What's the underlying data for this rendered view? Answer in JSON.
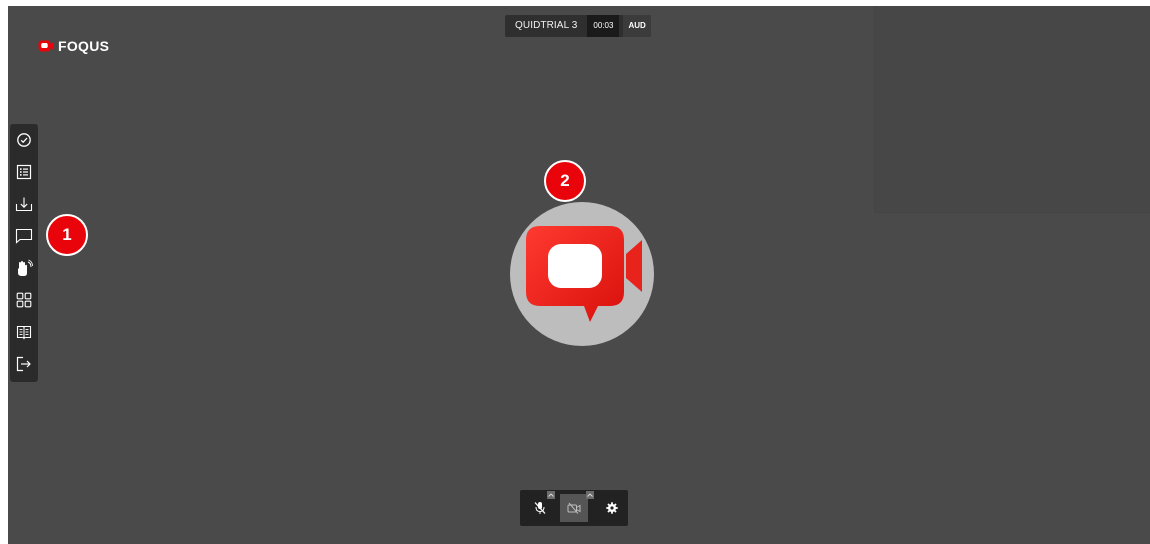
{
  "app": {
    "logo_text": "FOQUS",
    "brand_color": "#e8040a"
  },
  "topbar": {
    "room_name": "QUIDTRIAL 3",
    "timer": "00:03",
    "audio_label": "AUD"
  },
  "sidebar": {
    "items": [
      {
        "icon": "check-circle-icon"
      },
      {
        "icon": "list-icon"
      },
      {
        "icon": "download-icon"
      },
      {
        "icon": "chat-icon"
      },
      {
        "icon": "raise-hand-icon"
      },
      {
        "icon": "grid-view-icon"
      },
      {
        "icon": "book-icon"
      },
      {
        "icon": "exit-icon"
      }
    ]
  },
  "markers": {
    "first": "1",
    "second": "2"
  },
  "participant": {
    "avatar_icon": "video-camera-logo-icon"
  },
  "controls": {
    "items": [
      {
        "icon": "mic-muted-icon"
      },
      {
        "icon": "camera-off-icon"
      },
      {
        "icon": "settings-icon"
      }
    ]
  }
}
